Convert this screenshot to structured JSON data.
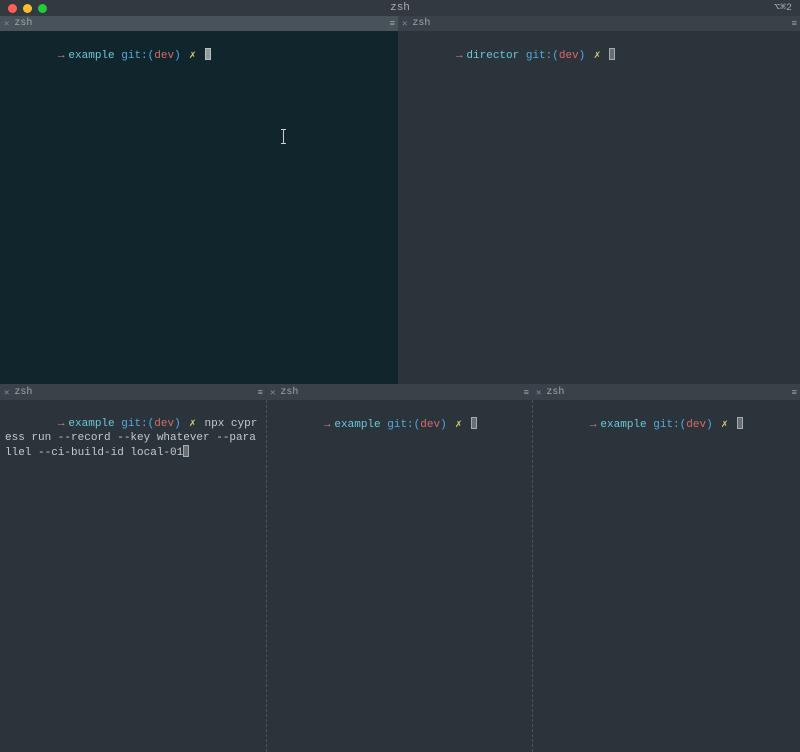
{
  "window": {
    "title": "zsh",
    "statusRight": "⌥⌘2"
  },
  "panes": {
    "topLeft": {
      "tab": "zsh",
      "prompt": {
        "arrow": "→",
        "dir": "example",
        "git_label": "git:(",
        "branch": "dev",
        "git_close": ")",
        "dirty": "✗",
        "cmd": ""
      }
    },
    "topRight": {
      "tab": "zsh",
      "prompt": {
        "arrow": "→",
        "dir": "director",
        "git_label": "git:(",
        "branch": "dev",
        "git_close": ")",
        "dirty": "✗",
        "cmd": ""
      }
    },
    "botLeft": {
      "tab": "zsh",
      "prompt": {
        "arrow": "→",
        "dir": "example",
        "git_label": "git:(",
        "branch": "dev",
        "git_close": ")",
        "dirty": "✗",
        "cmd": "npx cypress run --record --key whatever --parallel --ci-build-id local-01"
      }
    },
    "botMid": {
      "tab": "zsh",
      "prompt": {
        "arrow": "→",
        "dir": "example",
        "git_label": "git:(",
        "branch": "dev",
        "git_close": ")",
        "dirty": "✗",
        "cmd": ""
      }
    },
    "botRight": {
      "tab": "zsh",
      "prompt": {
        "arrow": "→",
        "dir": "example",
        "git_label": "git:(",
        "branch": "dev",
        "git_close": ")",
        "dirty": "✗",
        "cmd": ""
      }
    }
  }
}
